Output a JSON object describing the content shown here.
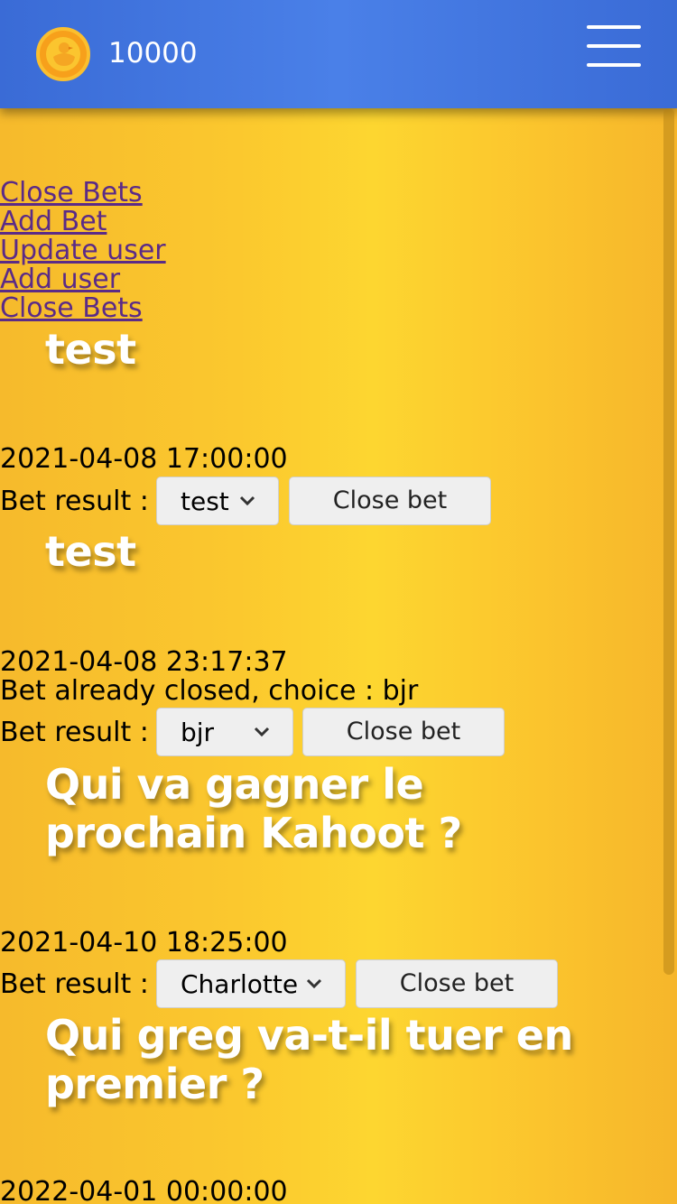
{
  "header": {
    "balance": "10000",
    "coin_icon": "duck-coin-icon",
    "menu_icon": "hamburger-menu-icon"
  },
  "admin_links": [
    "Close Bets",
    "Add Bet",
    "Update user",
    "Add user",
    "Close Bets"
  ],
  "result_label": "Bet result :",
  "close_button_label": "Close bet",
  "bets": [
    {
      "title": "test",
      "date": "2021-04-08 17:00:00",
      "status": "",
      "selected": "test"
    },
    {
      "title": "test",
      "date": "2021-04-08 23:17:37",
      "status": "Bet already closed, choice : bjr",
      "selected": "bjr"
    },
    {
      "title": "Qui va gagner le prochain Kahoot ?",
      "date": "2021-04-10 18:25:00",
      "status": "",
      "selected": "Charlotte"
    },
    {
      "title": "Qui greg va-t-il tuer en premier ?",
      "date": "2022-04-01 00:00:00",
      "status": "",
      "selected": ""
    }
  ],
  "colors": {
    "header_blue": "#4a80e8",
    "link_purple": "#5b2b87",
    "background_yellow": "#fdd630"
  }
}
